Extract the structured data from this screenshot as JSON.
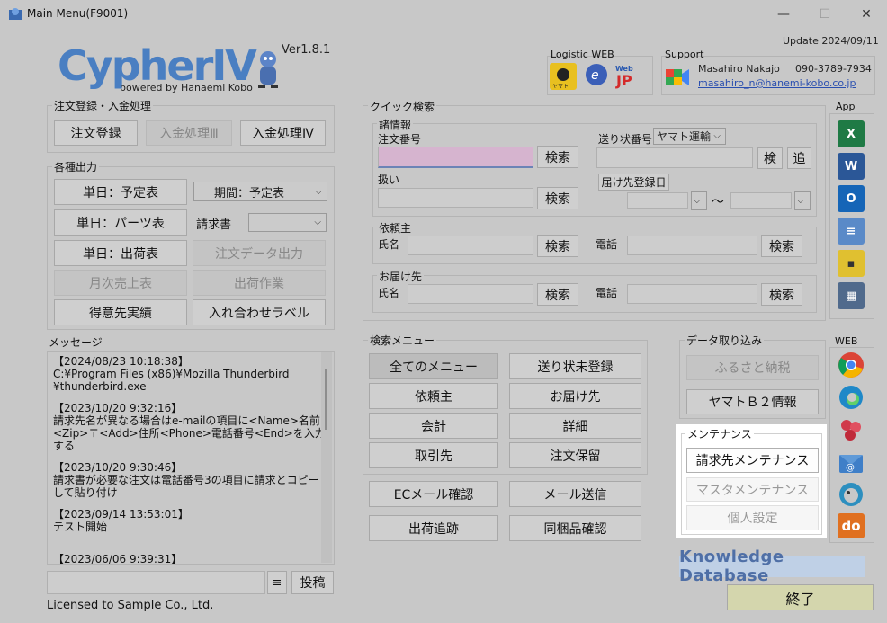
{
  "window": {
    "title": "Main Menu(F9001)",
    "minimize": "—",
    "maximize": "☐",
    "close": "✕"
  },
  "header": {
    "logo_text": "CypherⅣ",
    "logo_sub": "powered by Hanaemi Kobo",
    "version": "Ver1.8.1",
    "update": "Update 2024/09/11"
  },
  "logistic": {
    "label": "Logistic WEB",
    "icons": [
      "yamato-icon",
      "ecohai-icon",
      "japanpost-icon"
    ]
  },
  "support": {
    "label": "Support",
    "name": "Masahiro Nakajo",
    "phone": "090-3789-7934",
    "email": "masahiro_n@hanemi-kobo.co.jp"
  },
  "order_section": {
    "label": "注文登録・入金処理",
    "buttons": [
      "注文登録",
      "入金処理Ⅲ",
      "入金処理Ⅳ"
    ]
  },
  "output_section": {
    "label": "各種出力",
    "btn_schedule": "単日：予定表",
    "period_select": "期間：予定表",
    "btn_parts": "単日：パーツ表",
    "invoice_label": "請求書",
    "invoice_value": "",
    "btn_shipping": "単日：出荷表",
    "btn_export": "注文データ出力",
    "btn_monthly": "月次売上表",
    "btn_shipwork": "出荷作業",
    "btn_customer": "得意先実績",
    "btn_label": "入れ合わせラベル"
  },
  "messages": {
    "label": "メッセージ",
    "entries": [
      "【2024/08/23 10:18:38】\nC:¥Program Files (x86)¥Mozilla Thunderbird\n¥thunderbird.exe",
      "【2023/10/20 9:32:16】\n請求先名が異なる場合はe-mailの項目に<Name>名前<Zip>〒<Add>住所<Phone>電話番号<End>を入力する",
      "【2023/10/20 9:30:46】\n請求書が必要な注文は電話番号3の項目に請求とコピーして貼り付け",
      "【2023/09/14 13:53:01】\nテスト開始",
      "【2023/06/06 9:39:31】"
    ],
    "menu_btn": "≡",
    "post_btn": "投稿",
    "license": "Licensed to Sample Co., Ltd."
  },
  "quick_search": {
    "label": "クイック検索",
    "info_label": "諸情報",
    "order_no_label": "注文番号",
    "search": "検索",
    "handling_label": "扱い",
    "tracking_label": "送り状番号",
    "carrier": "ヤマト運輸",
    "ken": "検",
    "add": "追",
    "delivery_date_btn": "届け先登録日",
    "tilde": "～",
    "client_label": "依頼主",
    "name_label": "氏名",
    "phone_label": "電話",
    "dest_label": "お届け先"
  },
  "search_menu": {
    "label": "検索メニュー",
    "buttons": [
      "全てのメニュー",
      "送り状未登録",
      "依頼主",
      "お届け先",
      "会計",
      "詳細",
      "取引先",
      "注文保留"
    ],
    "extra": [
      "ECメール確認",
      "メール送信",
      "出荷追跡",
      "同梱品確認"
    ]
  },
  "data_import": {
    "label": "データ取り込み",
    "buttons": [
      "ふるさと納税",
      "ヤマトＢ２情報"
    ]
  },
  "maintenance": {
    "label": "メンテナンス",
    "buttons": [
      "請求先メンテナンス",
      "マスタメンテナンス",
      "個人設定"
    ]
  },
  "app_panel": {
    "label": "App",
    "icons": [
      "excel-icon",
      "word-icon",
      "outlook-icon",
      "notepad-icon",
      "sticky-notes-icon",
      "calculator-icon"
    ]
  },
  "web_panel": {
    "label": "WEB",
    "icons": [
      "chrome-icon",
      "edge-icon",
      "flower-app-icon",
      "mail-app-icon",
      "bird-app-icon",
      "do-app-icon"
    ]
  },
  "knowledge": "Knowledge Database",
  "exit_btn": "終了"
}
